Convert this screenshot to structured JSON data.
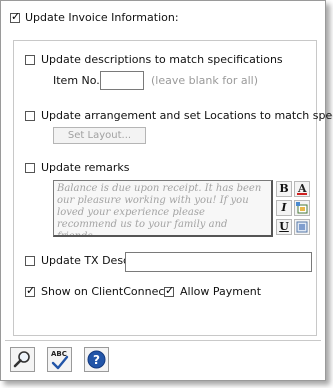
{
  "header": {
    "label": "Update Invoice Information:",
    "checked": true
  },
  "descriptions": {
    "label": "Update descriptions to match specifications",
    "checked": false,
    "item_no_label": "Item No.",
    "item_no_value": "",
    "item_no_hint": "(leave blank for all)"
  },
  "arrangement": {
    "label": "Update arrangement and set Locations to match specs.",
    "checked": false,
    "set_layout_label": "Set Layout..."
  },
  "remarks": {
    "label": "Update remarks",
    "checked": false,
    "text": "Balance is due upon receipt.  It has been our pleasure working with you!  If you loved your experience please recommend us to your family and friends.",
    "toolbar": {
      "bold": "B",
      "italic": "I",
      "underline": "U"
    }
  },
  "tx_desc": {
    "label": "Update TX Desc:",
    "checked": false,
    "value": ""
  },
  "client_connect": {
    "label": "Show on ClientConnect:",
    "checked": true
  },
  "allow_payment": {
    "label": "Allow Payment",
    "checked": true
  },
  "bottom_toolbar": {
    "spellcheck_label": "ABC"
  },
  "colors": {
    "accent": "#2255a8",
    "font_color_underline": "#d02020",
    "disabled_text": "#a0a0a0"
  }
}
